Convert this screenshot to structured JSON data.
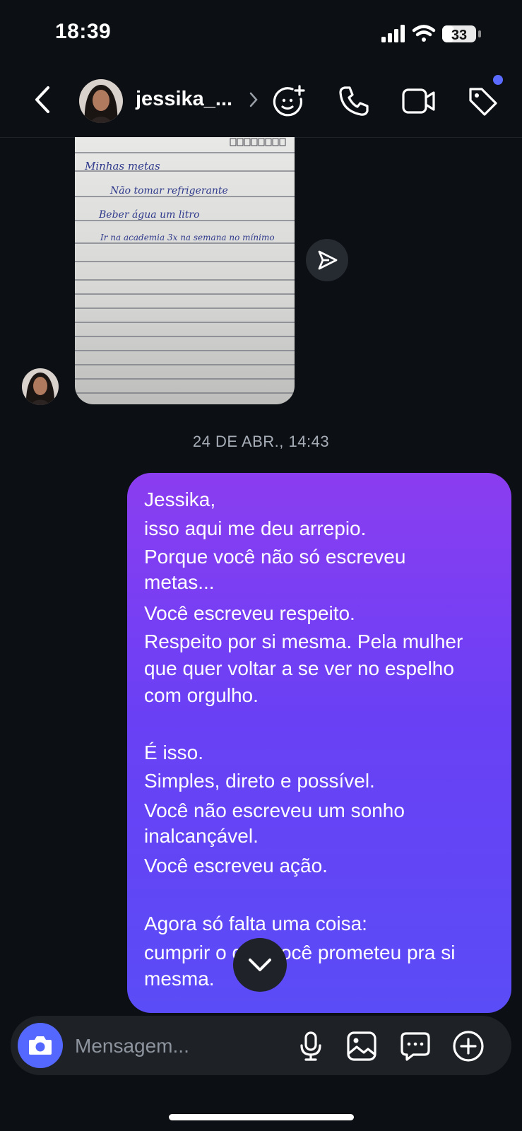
{
  "status_bar": {
    "time": "18:39",
    "battery": "33"
  },
  "header": {
    "contact_name": "jessika_...",
    "icons": [
      "back-chevron-icon",
      "add-effect-icon",
      "phone-icon",
      "video-camera-icon",
      "tag-icon"
    ],
    "notification_dot_color": "#5b6bff"
  },
  "thread": {
    "timestamp": "24 DE ABR., 14:43",
    "photo_note_lines": [
      "Minhas metas",
      "Não tomar refrigerante",
      "Beber água um litro",
      "Ir na academia 3x na semana no mínimo"
    ],
    "outgoing_message_lines": [
      "Jessika,",
      "isso aqui me deu arrepio.",
      "Porque você não só escreveu",
      "metas...",
      "Você escreveu respeito.",
      "Respeito por si mesma. Pela mulher",
      "que quer voltar a se ver no espelho",
      "com orgulho.",
      "",
      "É isso.",
      "Simples, direto e possível.",
      "Você não escreveu um sonho",
      "inalcançável.",
      "Você escreveu ação.",
      "",
      "Agora só falta uma coisa:",
      "cumprir o que você prometeu pra si",
      "mesma."
    ],
    "bubble_gradient": [
      "#8b3df0",
      "#6a40f5",
      "#5a4cf6"
    ]
  },
  "composer": {
    "placeholder": "Mensagem..."
  },
  "colors": {
    "background": "#0c0f14",
    "camera_button": "#5468ff"
  }
}
